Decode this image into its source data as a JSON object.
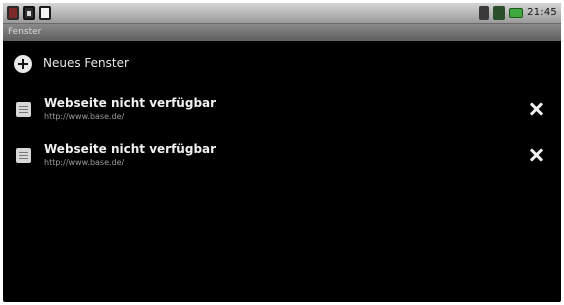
{
  "status_bar": {
    "icons_left": [
      "notification-icon",
      "notification-icon",
      "notification-icon"
    ],
    "icons_right": [
      "signal-icon",
      "network-icon",
      "battery-icon"
    ],
    "time": "21:45"
  },
  "header": {
    "title": "Fenster"
  },
  "new_window": {
    "label": "Neues Fenster",
    "icon": "plus-circle-icon"
  },
  "tabs": [
    {
      "title": "Webseite nicht verfügbar",
      "url": "http://www.base.de/",
      "icon": "page-icon",
      "close_icon": "close-icon"
    },
    {
      "title": "Webseite nicht verfügbar",
      "url": "http://www.base.de/",
      "icon": "page-icon",
      "close_icon": "close-icon"
    }
  ],
  "colors": {
    "background": "#000000",
    "status_bar": "#b8b8b8",
    "title_bar": "#707070",
    "text_primary": "#f0f0f0",
    "text_secondary": "#9b9b9b"
  }
}
